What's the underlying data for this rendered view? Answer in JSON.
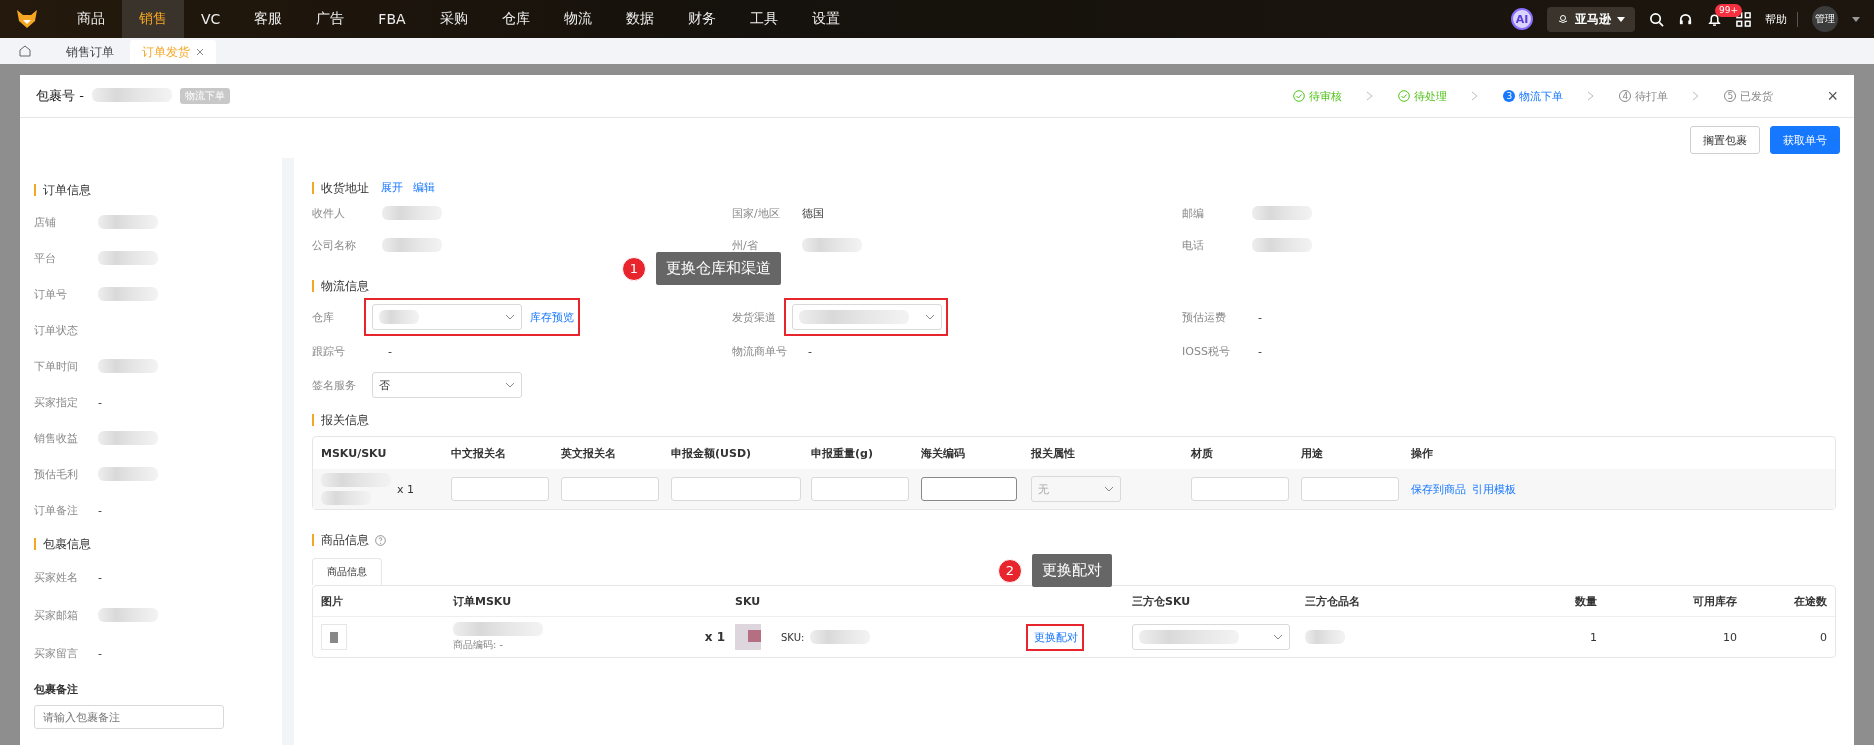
{
  "nav": {
    "items": [
      {
        "label": "商品",
        "selected": false
      },
      {
        "label": "销售",
        "selected": true
      },
      {
        "label": "VC",
        "selected": false
      },
      {
        "label": "客服",
        "selected": false
      },
      {
        "label": "广告",
        "selected": false
      },
      {
        "label": "FBA",
        "selected": false
      },
      {
        "label": "采购",
        "selected": false
      },
      {
        "label": "仓库",
        "selected": false
      },
      {
        "label": "物流",
        "selected": false
      },
      {
        "label": "数据",
        "selected": false
      },
      {
        "label": "财务",
        "selected": false
      },
      {
        "label": "工具",
        "selected": false
      },
      {
        "label": "设置",
        "selected": false
      }
    ],
    "ai": "AI",
    "store": "亚马逊",
    "notifications": "99+",
    "help": "帮助",
    "user": "管理"
  },
  "tabs": [
    {
      "label": "销售订单",
      "selected": false,
      "closable": false
    },
    {
      "label": "订单发货",
      "selected": true,
      "closable": true
    }
  ],
  "modal": {
    "title": "包裹号 -",
    "tag": "物流下单",
    "steps": [
      {
        "label": "待审核",
        "done": true,
        "selected": false
      },
      {
        "label": "待处理",
        "done": true,
        "selected": false
      },
      {
        "label": "物流下单",
        "number": "3",
        "done": false,
        "selected": true
      },
      {
        "label": "待打单",
        "number": "4",
        "done": false,
        "selected": false
      },
      {
        "label": "已发货",
        "number": "5",
        "done": false,
        "selected": false
      }
    ],
    "close": "×",
    "buttons": [
      {
        "label": "搁置包裹",
        "primary": false
      },
      {
        "label": "获取单号",
        "primary": true
      }
    ]
  },
  "order_info": {
    "title": "订单信息",
    "fields": [
      {
        "label": "店铺",
        "hidden": true
      },
      {
        "label": "平台",
        "hidden": true
      },
      {
        "label": "订单号",
        "hidden": true
      },
      {
        "label": "订单状态",
        "hidden": false
      },
      {
        "label": "下单时间",
        "hidden": true
      },
      {
        "label": "买家指定",
        "value": "-",
        "hidden": false
      },
      {
        "label": "销售收益",
        "hidden": true
      },
      {
        "label": "预估毛利",
        "hidden": true
      },
      {
        "label": "订单备注",
        "value": "-",
        "hidden": false
      }
    ]
  },
  "package_info": {
    "title": "包裹信息",
    "fields": [
      {
        "label": "买家姓名",
        "value": "-",
        "hidden": false
      },
      {
        "label": "买家邮箱",
        "hidden": true
      },
      {
        "label": "买家留言",
        "value": "-",
        "hidden": false
      }
    ],
    "remark_label": "包裹备注",
    "remark_placeholder": "请输入包裹备注"
  },
  "address": {
    "title": "收货地址",
    "links": [
      "展开",
      "编辑"
    ],
    "fields": [
      {
        "label": "收件人",
        "hidden": true
      },
      {
        "label": "国家/地区",
        "value": "德国",
        "hidden": false
      },
      {
        "label": "邮编",
        "hidden": true
      },
      {
        "label": "公司名称",
        "hidden": true
      },
      {
        "label": "州/省",
        "hidden": true
      },
      {
        "label": "电话",
        "hidden": true
      }
    ]
  },
  "logistics": {
    "title": "物流信息",
    "fields": [
      {
        "label": "仓库",
        "kind": "select",
        "hidden": true,
        "link": "库存预览",
        "highlighted": true
      },
      {
        "label": "发货渠道",
        "kind": "select",
        "hidden": true,
        "highlighted": true
      },
      {
        "label": "预估运费",
        "kind": "text",
        "value": "-"
      },
      {
        "label": "跟踪号",
        "kind": "text",
        "value": "-"
      },
      {
        "label": "物流商单号",
        "kind": "text",
        "value": "-"
      },
      {
        "label": "IOSS税号",
        "kind": "text",
        "value": "-"
      },
      {
        "label": "签名服务",
        "kind": "select",
        "value": "否",
        "hidden": false,
        "highlighted": false
      }
    ],
    "callout": {
      "number": "1",
      "text": "更换仓库和渠道"
    }
  },
  "customs": {
    "title": "报关信息",
    "columns": [
      "MSKU/SKU",
      "中文报关名",
      "英文报关名",
      "申报金额(USD)",
      "申报重量(g)",
      "海关编码",
      "报关属性",
      "材质",
      "用途",
      "操作"
    ],
    "row": {
      "quantity": "x 1",
      "attribute_placeholder": "无",
      "actions": [
        "保存到商品",
        "引用模板"
      ]
    }
  },
  "products": {
    "title": "商品信息",
    "tab": "商品信息",
    "columns": [
      "图片",
      "订单MSKU",
      "SKU",
      "三方仓SKU",
      "三方仓品名",
      "数量",
      "可用库存",
      "在途数"
    ],
    "row": {
      "code": "商品编码: -",
      "quantity": "x 1",
      "sku_label": "SKU:",
      "pair_link": "更换配对",
      "pair_highlighted": true,
      "count": "1",
      "available": "10",
      "in_transit": "0"
    },
    "callout": {
      "number": "2",
      "text": "更换配对"
    }
  }
}
